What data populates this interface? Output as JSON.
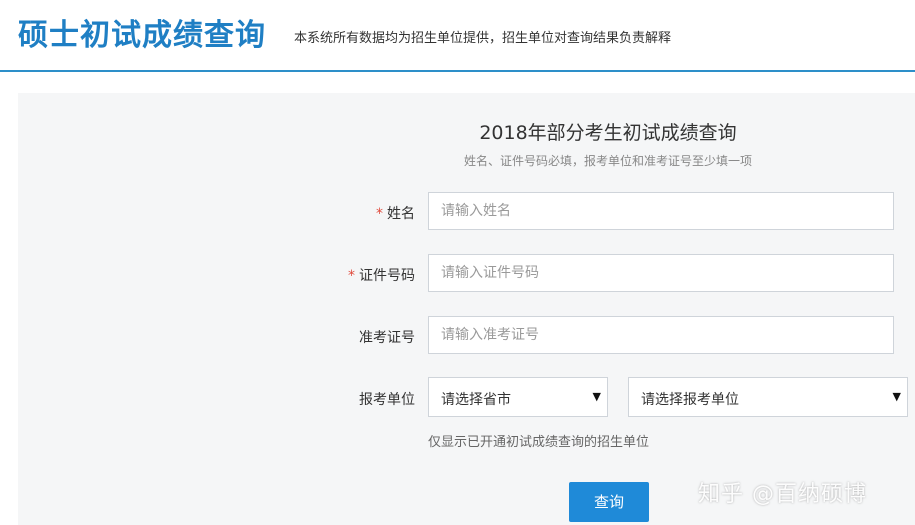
{
  "header": {
    "title": "硕士初试成绩查询",
    "subtitle": "本系统所有数据均为招生单位提供，招生单位对查询结果负责解释"
  },
  "form": {
    "title": "2018年部分考生初试成绩查询",
    "note": "姓名、证件号码必填，报考单位和准考证号至少填一项",
    "required_mark": "*",
    "name": {
      "label": "姓名",
      "placeholder": "请输入姓名",
      "value": ""
    },
    "id_number": {
      "label": "证件号码",
      "placeholder": "请输入证件号码",
      "value": ""
    },
    "exam_number": {
      "label": "准考证号",
      "placeholder": "请输入准考证号",
      "value": ""
    },
    "unit": {
      "label": "报考单位",
      "province_select": "请选择省市",
      "unit_select": "请选择报考单位",
      "hint": "仅显示已开通初试成绩查询的招生单位"
    },
    "submit_label": "查询"
  },
  "watermark": "知乎 @百纳硕博",
  "colors": {
    "brand": "#1f7fc4",
    "button": "#1f8ad8",
    "required": "#e04a3b",
    "panel_bg": "#f5f6f7"
  }
}
